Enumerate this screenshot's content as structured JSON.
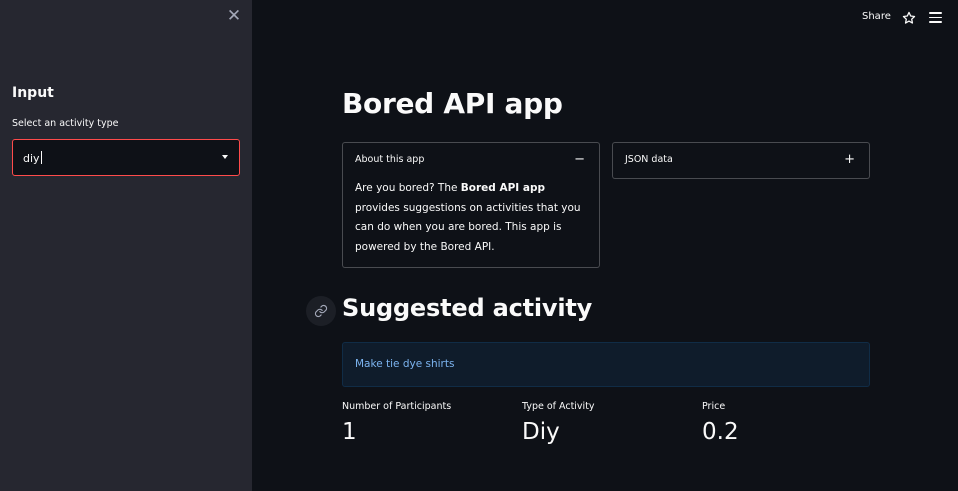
{
  "sidebar": {
    "close_icon": "close-icon",
    "heading": "Input",
    "select": {
      "label": "Select an activity type",
      "value": "diy"
    }
  },
  "topbar": {
    "share_label": "Share",
    "star_icon": "star-icon",
    "menu_icon": "hamburger-menu-icon"
  },
  "main": {
    "title": "Bored API app",
    "about_expander": {
      "header": "About this app",
      "toggle": "−",
      "body_prefix": "Are you bored? The ",
      "body_bold": "Bored API app",
      "body_suffix": " provides suggestions on activities that you can do when you are bored. This app is powered by the Bored API."
    },
    "json_expander": {
      "header": "JSON data",
      "toggle": "+"
    },
    "section_heading": "Suggested activity",
    "activity": "Make tie dye shirts",
    "metrics": [
      {
        "label": "Number of Participants",
        "value": "1"
      },
      {
        "label": "Type of Activity",
        "value": "Diy"
      },
      {
        "label": "Price",
        "value": "0.2"
      }
    ]
  },
  "colors": {
    "sidebar_bg": "#262730",
    "main_bg": "#0e1117",
    "accent_red": "#ff4b4b",
    "info_text": "#7cb4f0"
  }
}
